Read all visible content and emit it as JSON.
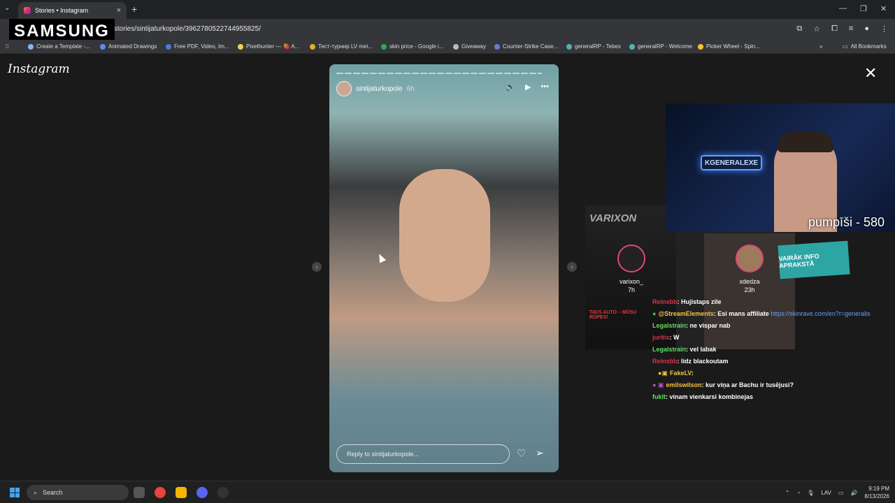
{
  "browser": {
    "tab_title": "Stories • Instagram",
    "url": "/stories/sintijaturkopole/3962780522744955825/",
    "bookmarks": [
      {
        "label": "Create a Template -...",
        "color": "#8ab4f8"
      },
      {
        "label": "Animated Drawings",
        "color": "#5b8def"
      },
      {
        "label": "Free PDF, Video, Im...",
        "color": "#4a7bd8"
      },
      {
        "label": "Pixelhunter — 🍓 A...",
        "color": "#f0d050"
      },
      {
        "label": "Тест-турнир LV mei...",
        "color": "#e0b020"
      },
      {
        "label": "skin price - Google i...",
        "color": "#31a852"
      },
      {
        "label": "Giveaway",
        "color": "#bbbbbb"
      },
      {
        "label": "Counter-Strike Case...",
        "color": "#6a7cd8"
      },
      {
        "label": "generalRP - Tebex",
        "color": "#4db6ac"
      },
      {
        "label": "generalRP - Welcome",
        "color": "#4db6ac"
      },
      {
        "label": "Picker Wheel - Spin...",
        "color": "#f4c430"
      }
    ],
    "all_bookmarks": "All Bookmarks",
    "overlay_brand": "SAMSUNG"
  },
  "page": {
    "logo": "Instagram",
    "close": "✕"
  },
  "story": {
    "username": "sintijaturkopole",
    "time": "6h",
    "reply_placeholder": "Reply to sintijaturkopole..."
  },
  "overlay": {
    "pump_text": "pumpīši - 580",
    "neon_sign": "KGENERALEXE",
    "varix_title": "VARIXON",
    "varix_bottom": "TAVS AUTO – MŪSU RŪPES!",
    "vairak": "VAIRĀK INFO APRAKSTĀ",
    "stories": [
      {
        "name": "varixon_",
        "time": "7h"
      },
      {
        "name": "xdedza",
        "time": "23h"
      }
    ],
    "chat": [
      {
        "user": "Reinxbb",
        "color": "#e0304a",
        "msg": ": Hujistaps zile"
      },
      {
        "user": "@StreamElements",
        "color": "#f5c242",
        "msg": ": Esi mans affiliate ",
        "link": "https://skinrave.com/en?r=generalis"
      },
      {
        "user": "Legalstrain",
        "color": "#5fe05f",
        "msg": ": ne vispar nab"
      },
      {
        "user": "juritis",
        "color": "#e0304a",
        "msg": ": W"
      },
      {
        "user": "Legalstrain",
        "color": "#5fe05f",
        "msg": ": vel labak"
      },
      {
        "user": "Reinxbb",
        "color": "#e0304a",
        "msg": ": lidz blackoutam"
      },
      {
        "user": "FakeLV",
        "color": "#f5c242",
        "msg": ":"
      },
      {
        "user": "emilswilson",
        "color": "#f5c242",
        "msg": ": kur viņa ar Bachu ir tusējusi?"
      },
      {
        "user": "fuklt",
        "color": "#5fe05f",
        "msg": ": vinam vienkarsi kombinejas"
      }
    ]
  },
  "taskbar": {
    "search": "Search",
    "lang": "LAV",
    "time": "9:19 PM",
    "date": "8/13/2026"
  }
}
